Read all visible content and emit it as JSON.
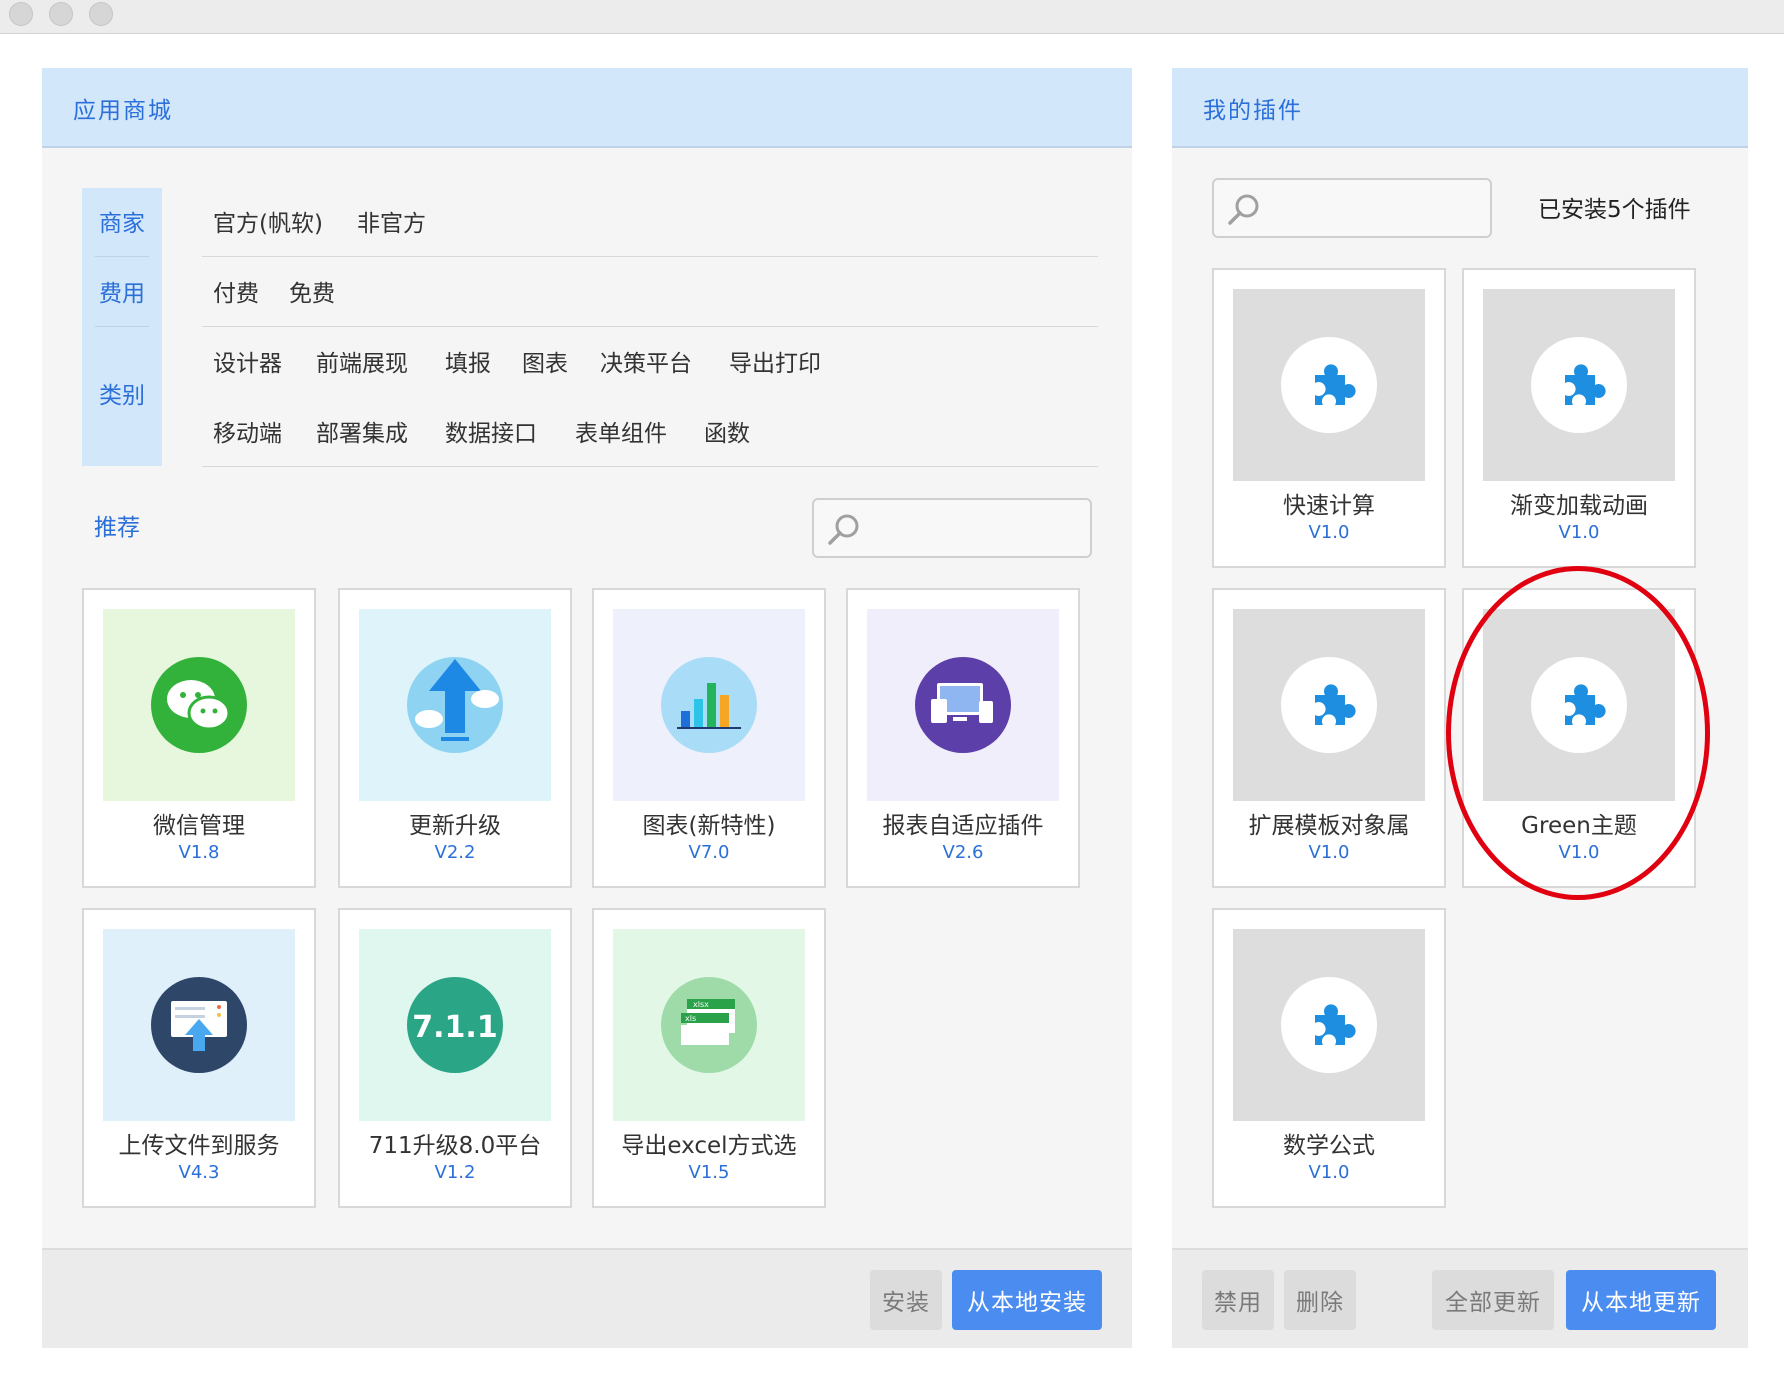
{
  "store": {
    "title": "应用商城",
    "filters": {
      "merchant_label": "商家",
      "merchant_options": [
        "官方(帆软)",
        "非官方"
      ],
      "cost_label": "费用",
      "cost_options": [
        "付费",
        "免费"
      ],
      "category_label": "类别",
      "category_row1": [
        "设计器",
        "前端展现",
        "填报",
        "图表",
        "决策平台",
        "导出打印"
      ],
      "category_row2": [
        "移动端",
        "部署集成",
        "数据接口",
        "表单组件",
        "函数"
      ]
    },
    "recommend_label": "推荐",
    "search_placeholder": "",
    "plugins": [
      {
        "name": "微信管理",
        "version": "V1.8",
        "icon": "wechat-icon"
      },
      {
        "name": "更新升级",
        "version": "V2.2",
        "icon": "upload-cloud-icon"
      },
      {
        "name": "图表(新特性)",
        "version": "V7.0",
        "icon": "bar-chart-icon"
      },
      {
        "name": "报表自适应插件",
        "version": "V2.6",
        "icon": "devices-icon"
      },
      {
        "name": "上传文件到服务",
        "version": "V4.3",
        "icon": "file-upload-icon"
      },
      {
        "name": "711升级8.0平台",
        "version": "V1.2",
        "icon": "version-badge-icon",
        "badge": "7.1.1"
      },
      {
        "name": "导出excel方式选",
        "version": "V1.5",
        "icon": "excel-export-icon",
        "tags": [
          "xlsx",
          "xls"
        ]
      }
    ],
    "buttons": {
      "install": "安装",
      "local_install": "从本地安装"
    }
  },
  "mine": {
    "title": "我的插件",
    "installed_count": "已安装5个插件",
    "search_placeholder": "",
    "plugins": [
      {
        "name": "快速计算",
        "version": "V1.0",
        "icon": "puzzle-icon"
      },
      {
        "name": "渐变加载动画",
        "version": "V1.0",
        "icon": "puzzle-icon"
      },
      {
        "name": "扩展模板对象属",
        "version": "V1.0",
        "icon": "puzzle-icon"
      },
      {
        "name": "Green主题",
        "version": "V1.0",
        "icon": "puzzle-icon"
      },
      {
        "name": "数学公式",
        "version": "V1.0",
        "icon": "puzzle-icon"
      }
    ],
    "buttons": {
      "disable": "禁用",
      "delete": "删除",
      "update_all": "全部更新",
      "local_update": "从本地更新"
    }
  },
  "colors": {
    "accent": "#2b6fd8",
    "header_bg": "#d3e7fb",
    "button_blue": "#4a8cf0",
    "highlight_ring": "#e00010"
  }
}
